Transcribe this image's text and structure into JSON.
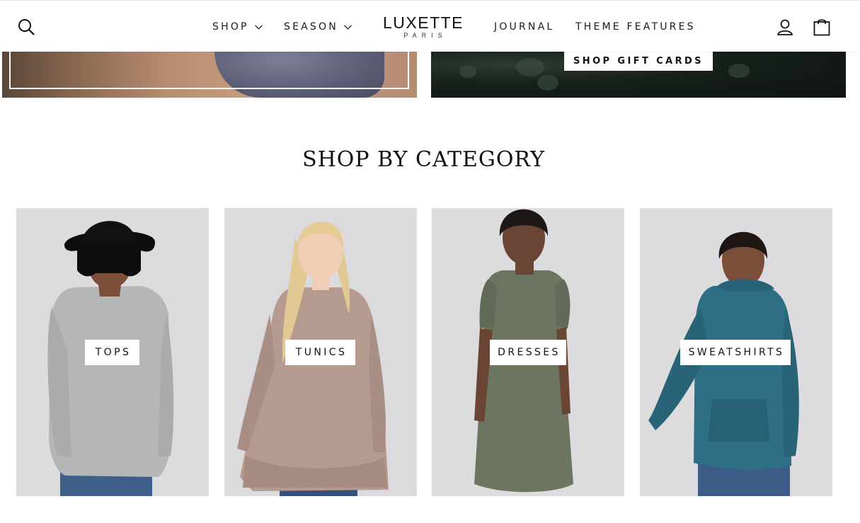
{
  "header": {
    "logo": {
      "main": "LUXETTE",
      "sub": "PARIS"
    },
    "nav": {
      "shop": "SHOP",
      "season": "SEASON",
      "journal": "JOURNAL",
      "theme_features": "THEME FEATURES"
    },
    "icons": [
      "search-icon",
      "chevron-down-icon",
      "user-icon",
      "shopping-bag-icon"
    ]
  },
  "banners": {
    "gift_cards_button": "SHOP GIFT CARDS"
  },
  "section": {
    "title": "SHOP BY CATEGORY"
  },
  "categories": [
    {
      "label": "TOPS",
      "shirt_color": "#b4b6b8"
    },
    {
      "label": "TUNICS",
      "shirt_color": "#b59a8f"
    },
    {
      "label": "DRESSES",
      "shirt_color": "#6b7560"
    },
    {
      "label": "SWEATSHIRTS",
      "shirt_color": "#2f6f86"
    }
  ],
  "colors": {
    "text": "#111111",
    "card_background": "#dfdfe1",
    "label_background": "#ffffff"
  }
}
